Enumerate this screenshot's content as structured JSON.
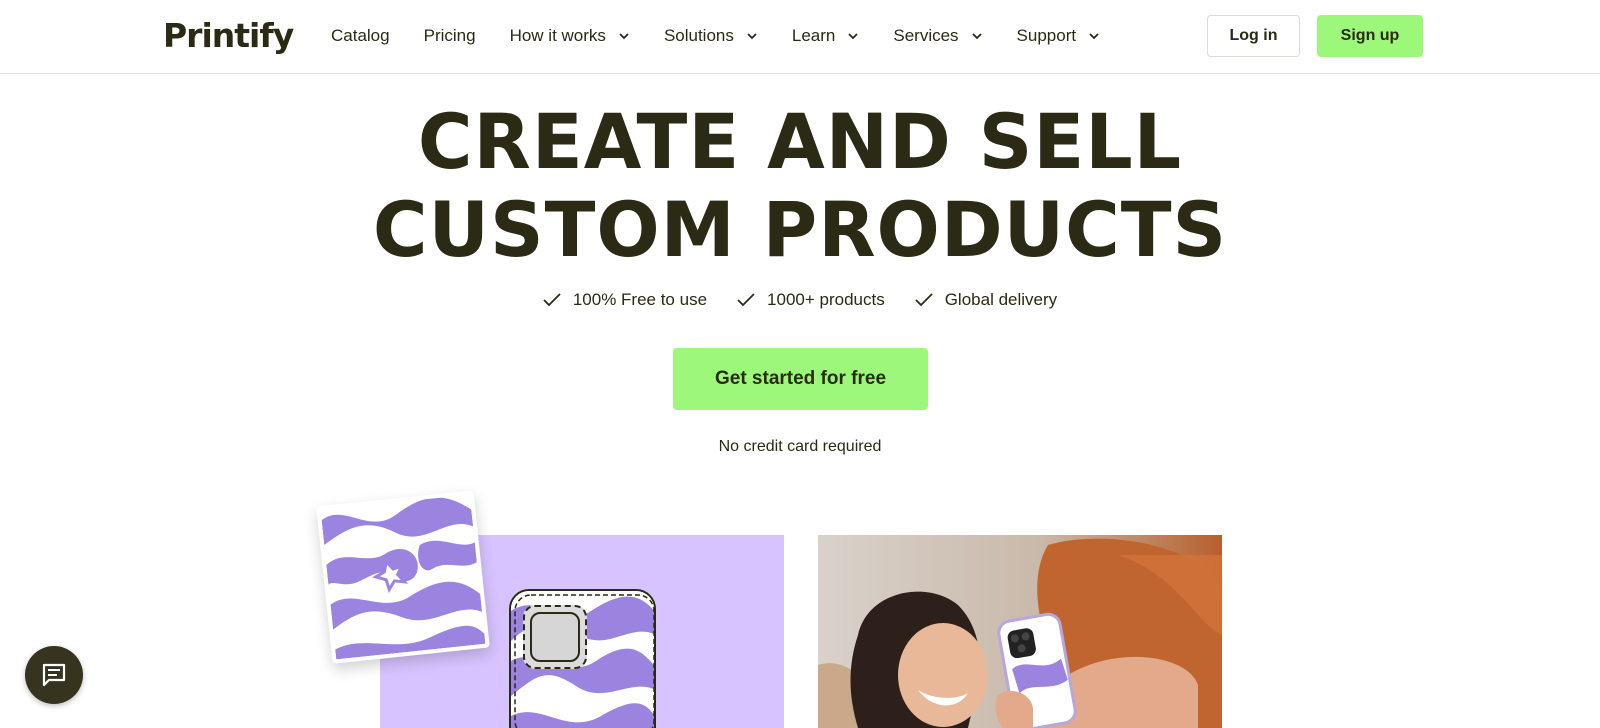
{
  "header": {
    "logo": "Printify",
    "nav": [
      {
        "label": "Catalog",
        "dropdown": false
      },
      {
        "label": "Pricing",
        "dropdown": false
      },
      {
        "label": "How it works",
        "dropdown": true
      },
      {
        "label": "Solutions",
        "dropdown": true
      },
      {
        "label": "Learn",
        "dropdown": true
      },
      {
        "label": "Services",
        "dropdown": true
      },
      {
        "label": "Support",
        "dropdown": true
      }
    ],
    "login_label": "Log in",
    "signup_label": "Sign up"
  },
  "hero": {
    "title_line1": "CREATE AND SELL",
    "title_line2": "CUSTOM PRODUCTS",
    "features": [
      "100% Free to use",
      "1000+ products",
      "Global delivery"
    ],
    "cta_label": "Get started for free",
    "note": "No credit card required"
  },
  "colors": {
    "brand_dark": "#2b2a14",
    "accent_green": "#9cf77a",
    "lavender": "#d7c3ff",
    "pattern_purple": "#9b83e0"
  },
  "icons": {
    "nav_dropdown": "chevron-down-icon",
    "feature": "check-icon",
    "chat": "chat-icon"
  }
}
